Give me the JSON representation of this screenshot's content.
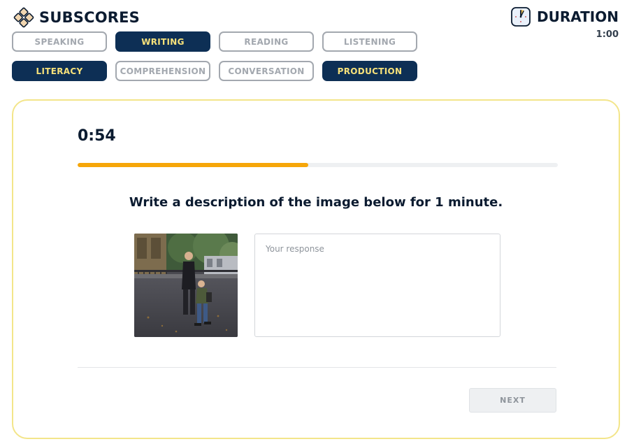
{
  "header": {
    "title": "SUBSCORES",
    "duration_label": "DURATION",
    "duration_value": "1:00"
  },
  "subscores": {
    "row1": [
      {
        "label": "SPEAKING",
        "active": false
      },
      {
        "label": "WRITING",
        "active": true
      },
      {
        "label": "READING",
        "active": false
      },
      {
        "label": "LISTENING",
        "active": false
      }
    ],
    "row2": [
      {
        "label": "LITERACY",
        "active": true
      },
      {
        "label": "COMPREHENSION",
        "active": false
      },
      {
        "label": "CONVERSATION",
        "active": false
      },
      {
        "label": "PRODUCTION",
        "active": true
      }
    ]
  },
  "task": {
    "timer": "0:54",
    "progress": 0.48,
    "prompt": "Write a description of the image below for 1 minute.",
    "response_placeholder": "Your response",
    "response_value": "",
    "next_label": "NEXT"
  },
  "colors": {
    "accent_dark": "#0d2f55",
    "accent_yellow": "#f6e17a",
    "progress": "#f6a609",
    "card_border": "#f3e58a"
  }
}
